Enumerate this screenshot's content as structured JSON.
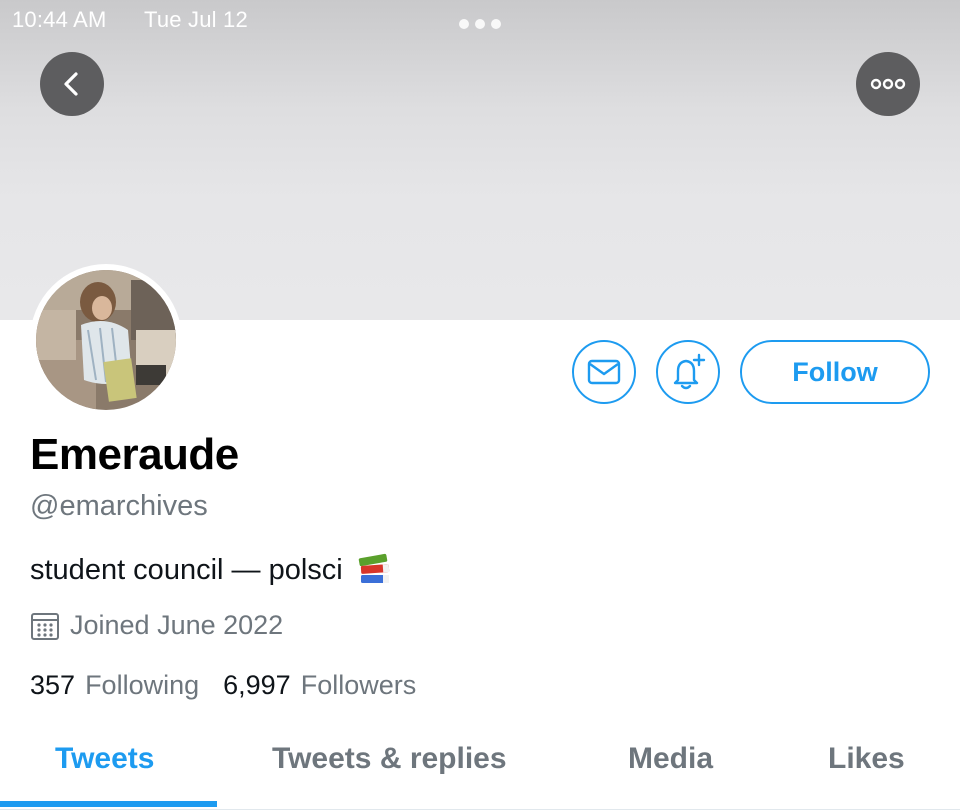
{
  "status_bar": {
    "time": "10:44 AM",
    "date": "Tue Jul 12"
  },
  "header": {
    "back_icon": "chevron-left-icon",
    "more_icon": "more-horizontal-icon"
  },
  "profile": {
    "display_name": "Emeraude",
    "handle": "@emarchives",
    "bio": "student council — polsci",
    "bio_emoji": "books-emoji",
    "joined": "Joined June 2022",
    "following_count": "357",
    "following_label": "Following",
    "followers_count": "6,997",
    "followers_label": "Followers"
  },
  "actions": {
    "message_icon": "mail-icon",
    "notify_icon": "bell-plus-icon",
    "follow_label": "Follow"
  },
  "tabs": [
    {
      "label": "Tweets",
      "active": true
    },
    {
      "label": "Tweets & replies",
      "active": false
    },
    {
      "label": "Media",
      "active": false
    },
    {
      "label": "Likes",
      "active": false
    }
  ],
  "colors": {
    "accent": "#1d9bf0",
    "secondary_text": "#6e767d",
    "banner": "#e6e6e8"
  }
}
